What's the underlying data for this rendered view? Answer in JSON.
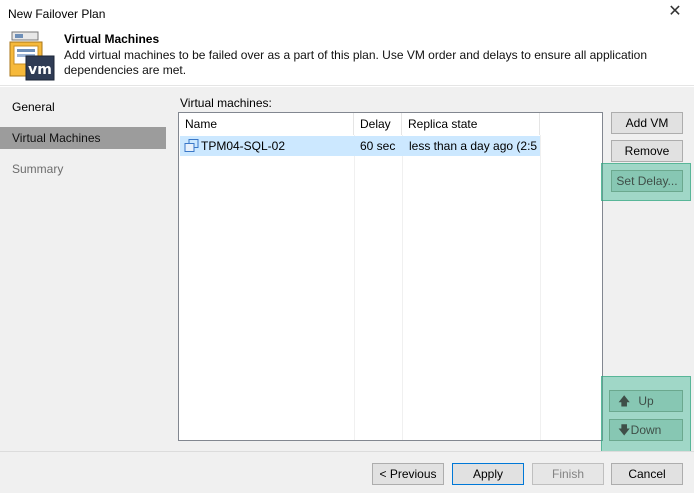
{
  "window": {
    "title": "New Failover Plan"
  },
  "header": {
    "title": "Virtual Machines",
    "description": "Add virtual machines to be failed over as a part of this plan. Use VM order and delays to ensure all application dependencies are met.",
    "icon_text": "vm"
  },
  "nav": {
    "items": [
      {
        "label": "General",
        "state": "normal"
      },
      {
        "label": "Virtual Machines",
        "state": "selected"
      },
      {
        "label": "Summary",
        "state": "disabled"
      }
    ]
  },
  "vm_list": {
    "label": "Virtual machines:",
    "columns": [
      "Name",
      "Delay",
      "Replica state"
    ],
    "rows": [
      {
        "name": "TPM04-SQL-02",
        "delay": "60 sec",
        "replica_state": "less than a day ago (2:5..."
      }
    ]
  },
  "side_buttons": {
    "add_vm": "Add VM",
    "remove": "Remove",
    "set_delay": "Set Delay...",
    "up": "Up",
    "down": "Down"
  },
  "footer": {
    "previous": "< Previous",
    "apply": "Apply",
    "finish": "Finish",
    "cancel": "Cancel"
  },
  "colors": {
    "selection": "#cce8ff",
    "nav_selected": "#9c9c9c",
    "highlight": "#3eb894"
  }
}
